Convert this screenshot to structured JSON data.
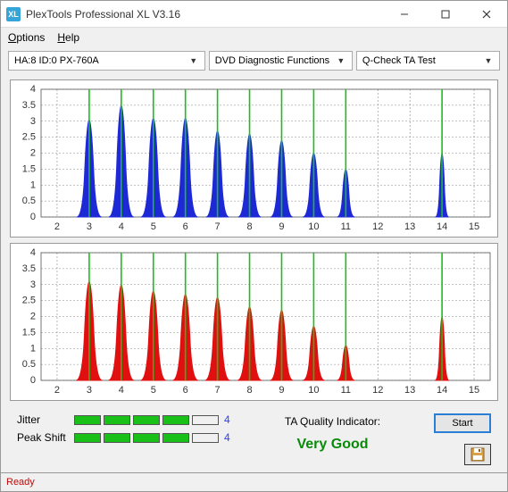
{
  "window": {
    "title": "PlexTools Professional XL V3.16",
    "icon_text": "XL"
  },
  "menu": {
    "options": "Options",
    "help": "Help"
  },
  "dropdowns": {
    "device": "HA:8 ID:0   PX-760A",
    "mode": "DVD Diagnostic Functions",
    "test": "Q-Check TA Test"
  },
  "chart_data": [
    {
      "type": "histogram-peaks",
      "color": "#1e29d6",
      "xlim": [
        1.5,
        15.5
      ],
      "ylim": [
        0,
        4
      ],
      "xticks": [
        2,
        3,
        4,
        5,
        6,
        7,
        8,
        9,
        10,
        11,
        12,
        13,
        14,
        15
      ],
      "yticks": [
        0,
        0.5,
        1,
        1.5,
        2,
        2.5,
        3,
        3.5,
        4
      ],
      "vlines": [
        3,
        4,
        5,
        6,
        7,
        8,
        9,
        10,
        11,
        14
      ],
      "peaks": [
        {
          "c": 3,
          "h": 3.05,
          "w": 0.78
        },
        {
          "c": 4,
          "h": 3.5,
          "w": 0.78
        },
        {
          "c": 5,
          "h": 3.1,
          "w": 0.78
        },
        {
          "c": 6,
          "h": 3.1,
          "w": 0.78
        },
        {
          "c": 7,
          "h": 2.7,
          "w": 0.72
        },
        {
          "c": 8,
          "h": 2.6,
          "w": 0.72
        },
        {
          "c": 9,
          "h": 2.4,
          "w": 0.7
        },
        {
          "c": 10,
          "h": 2.0,
          "w": 0.68
        },
        {
          "c": 11,
          "h": 1.5,
          "w": 0.55
        },
        {
          "c": 14,
          "h": 2.0,
          "w": 0.42
        }
      ]
    },
    {
      "type": "histogram-peaks",
      "color": "#e01010",
      "xlim": [
        1.5,
        15.5
      ],
      "ylim": [
        0,
        4
      ],
      "xticks": [
        2,
        3,
        4,
        5,
        6,
        7,
        8,
        9,
        10,
        11,
        12,
        13,
        14,
        15
      ],
      "yticks": [
        0,
        0.5,
        1,
        1.5,
        2,
        2.5,
        3,
        3.5,
        4
      ],
      "vlines": [
        3,
        4,
        5,
        6,
        7,
        8,
        9,
        10,
        11,
        14
      ],
      "peaks": [
        {
          "c": 3,
          "h": 3.1,
          "w": 0.82
        },
        {
          "c": 4,
          "h": 3.0,
          "w": 0.8
        },
        {
          "c": 5,
          "h": 2.8,
          "w": 0.8
        },
        {
          "c": 6,
          "h": 2.7,
          "w": 0.8
        },
        {
          "c": 7,
          "h": 2.6,
          "w": 0.78
        },
        {
          "c": 8,
          "h": 2.3,
          "w": 0.76
        },
        {
          "c": 9,
          "h": 2.2,
          "w": 0.72
        },
        {
          "c": 10,
          "h": 1.7,
          "w": 0.68
        },
        {
          "c": 11,
          "h": 1.1,
          "w": 0.56
        },
        {
          "c": 14,
          "h": 2.0,
          "w": 0.44
        }
      ]
    }
  ],
  "metrics": {
    "jitter_label": "Jitter",
    "peakshift_label": "Peak Shift",
    "jitter_value": "4",
    "peakshift_value": "4",
    "jitter_bars": 4,
    "peakshift_bars": 4,
    "bar_total": 5
  },
  "quality": {
    "label": "TA Quality Indicator:",
    "value": "Very Good"
  },
  "buttons": {
    "start": "Start"
  },
  "status": "Ready"
}
